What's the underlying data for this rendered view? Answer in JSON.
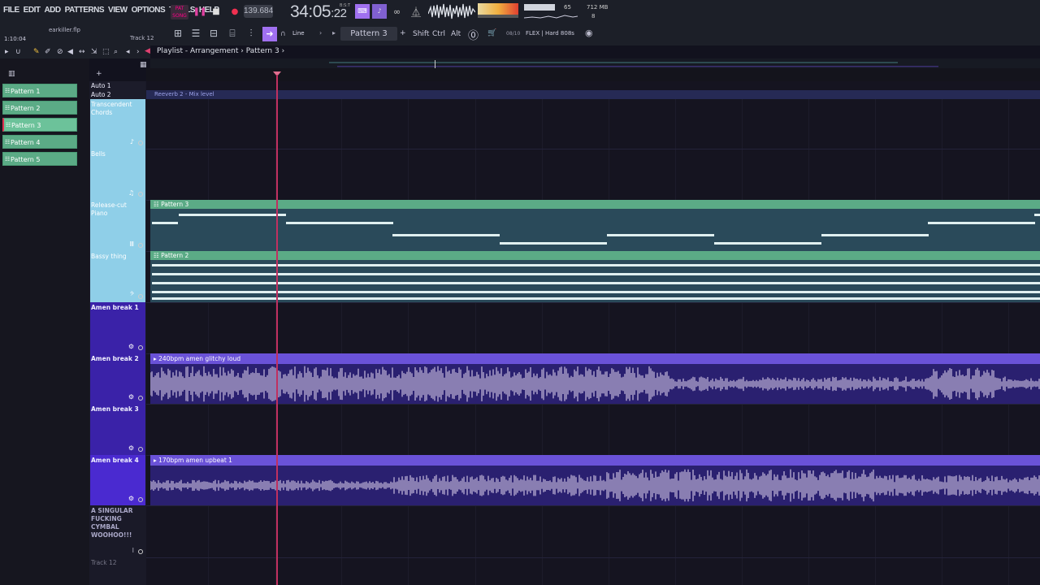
{
  "menu": [
    "FILE",
    "EDIT",
    "ADD",
    "PATTERNS",
    "VIEW",
    "OPTIONS",
    "TOOLS",
    "HELP"
  ],
  "transport": {
    "pat_song_label": "PAT SONG",
    "tempo": "139.684",
    "time": "34:05",
    "time_frac": ":22",
    "time_suffix": "B:S:T",
    "cpu_value": "65",
    "memory": "712 MB",
    "polyphony": "8"
  },
  "toolbar": {
    "clock": "1:10:04",
    "filename": "earkiller.flp",
    "track_hint": "Track 12",
    "snap": "Line",
    "pattern": "Pattern 3",
    "shift": "Shift",
    "ctrl": "Ctrl",
    "alt": "Alt",
    "preset_count": "08/10",
    "preset_name": "FLEX | Hard 808s"
  },
  "playlist": {
    "title": "Playlist - Arrangement",
    "crumb": "Pattern 3",
    "title_sep": "›",
    "crumb_sep": "›"
  },
  "patterns": [
    {
      "label": "Pattern 1"
    },
    {
      "label": "Pattern 2"
    },
    {
      "label": "Pattern 3"
    },
    {
      "label": "Pattern 4"
    },
    {
      "label": "Pattern 5"
    }
  ],
  "auto_tracks": {
    "auto1": "Auto 1",
    "auto2": "Auto 2"
  },
  "automation_clip": "Reeverb 2 - Mix level",
  "tracks": [
    {
      "name": "Transcendent Chords",
      "color": "#8fcfe8"
    },
    {
      "name": "Bells",
      "color": "#8fcfe8"
    },
    {
      "name": "Release-cut Piano",
      "color": "#8fcfe8"
    },
    {
      "name": "Bassy thing",
      "color": "#8fcfe8"
    },
    {
      "name": "Amen break 1",
      "color": "#3a22a8"
    },
    {
      "name": "Amen break 2",
      "color": "#3a22a8"
    },
    {
      "name": "Amen break 3",
      "color": "#3a22a8"
    },
    {
      "name": "Amen break 4",
      "color": "#4a2ad0"
    },
    {
      "name": "A SINGULAR FUCKING CYMBAL WOOHOO!!!",
      "color": "#1a1a28"
    },
    {
      "name": "Track 12",
      "color": "#1a1a28"
    }
  ],
  "clips": {
    "piano": "Pattern 3",
    "bass": "Pattern 2",
    "amen2": "240bpm amen glitchy loud",
    "amen4": "170bpm amen upbeat 1"
  },
  "colors": {
    "pattern_green": "#5bab86",
    "accent_purple": "#a070f0",
    "audio_clip": "#6a52d8",
    "playhead": "#c03060"
  }
}
